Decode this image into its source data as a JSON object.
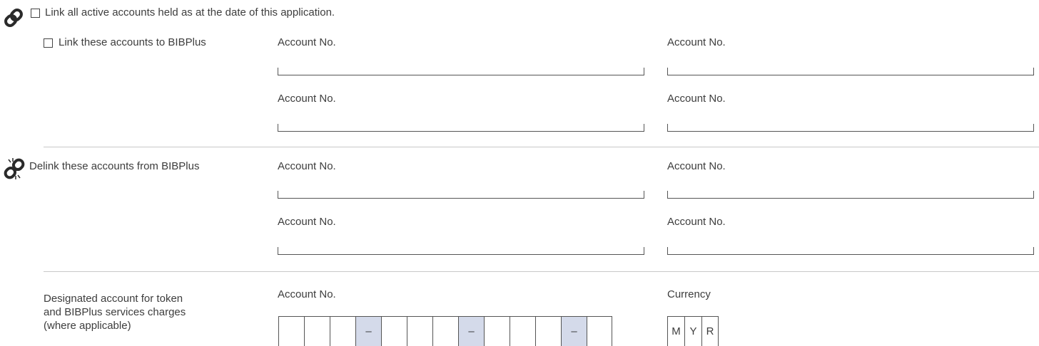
{
  "link_all_label": "Link all active accounts held as at the date of this application.",
  "link_these_label": "Link these accounts to BIBPlus",
  "delink_label": "Delink these accounts from BIBPlus",
  "account_label": "Account No.",
  "designated_lines": [
    "Designated account for token",
    "and BIBPlus services charges",
    "(where applicable)"
  ],
  "currency_label": "Currency",
  "account_separator": "–",
  "currency_chars": [
    "M",
    "Y",
    "R"
  ],
  "icons": {
    "link": "link-chain-icon",
    "delink": "broken-chain-icon"
  },
  "colors": {
    "separator_fill": "#d4daea",
    "text": "#3d3d3d",
    "divider": "#c8c8c8"
  }
}
